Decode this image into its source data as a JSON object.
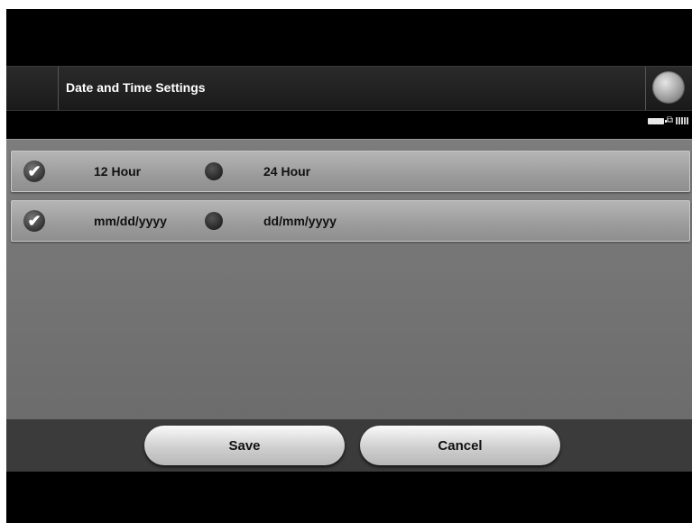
{
  "header": {
    "title": "Date and Time Settings"
  },
  "rows": [
    {
      "selected_label": "12 Hour",
      "option_label": "24 Hour"
    },
    {
      "selected_label": "mm/dd/yyyy",
      "option_label": "dd/mm/yyyy"
    }
  ],
  "footer": {
    "save_label": "Save",
    "cancel_label": "Cancel"
  },
  "icons": {
    "home": "home-button-icon",
    "check": "checkmark-icon",
    "radio": "radio-off-icon",
    "battery": "battery-icon",
    "wireless": "wireless-icon",
    "signal": "signal-bars-icon"
  }
}
